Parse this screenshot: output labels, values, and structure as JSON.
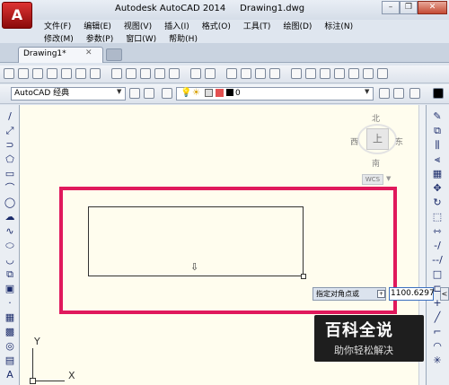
{
  "window": {
    "title": "Autodesk AutoCAD 2014     Drawing1.dwg",
    "minimize_glyph": "–",
    "restore_glyph": "❐",
    "close_glyph": "✕",
    "app_button_letter": "A"
  },
  "menus": {
    "row1": [
      "文件(F)",
      "编辑(E)",
      "视图(V)",
      "插入(I)",
      "格式(O)",
      "工具(T)",
      "绘图(D)",
      "标注(N)"
    ],
    "row2": [
      "修改(M)",
      "参数(P)",
      "窗口(W)",
      "帮助(H)"
    ]
  },
  "tabs": {
    "document_tab": "Drawing1*",
    "close_glyph": "✕"
  },
  "toolbar": {
    "workspace": "AutoCAD 经典",
    "layer_name": "0",
    "combo_arrow": "▼"
  },
  "viewcube": {
    "north": "北",
    "south": "南",
    "west": "西",
    "east": "东",
    "top": "上",
    "coordinate_system": "WCS",
    "ucs_arrow": "▼"
  },
  "dynamic_input": {
    "prompt": "指定对角点或",
    "toggle": "+",
    "value": "1100.6297",
    "next_glyph": "<"
  },
  "ucs_icon": {
    "x_label": "X",
    "y_label": "Y"
  },
  "cursor_glyph": "⇩",
  "watermark": {
    "title": "百科全说",
    "subtitle": "助你轻松解决"
  },
  "colors": {
    "highlight": "#e0195c",
    "canvas": "#fffdee",
    "app_button": "#c81818"
  }
}
